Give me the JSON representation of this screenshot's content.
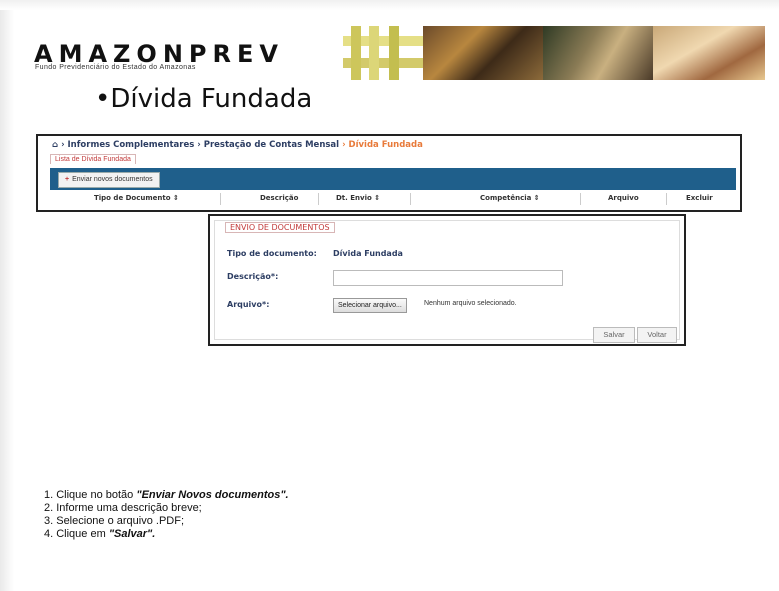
{
  "logo": {
    "title": "AMAZONPREV",
    "subtitle": "Fundo Previdenciário do Estado do Amazonas"
  },
  "slide_title": "•Dívida Fundada",
  "breadcrumb": {
    "home_icon": "home-icon",
    "item1": "› Informes Complementares",
    "item2": "› Prestação de Contas Mensal",
    "item3": "› Dívida Fundada"
  },
  "list_tab": "Lista de Dívida Fundada",
  "toolbar": {
    "enviar_icon": "plus-icon",
    "enviar_label": "Enviar novos documentos"
  },
  "table": {
    "columns": [
      "Tipo de Documento ⇕",
      "Descrição",
      "Dt. Envio ⇕",
      "Competência ⇕",
      "Arquivo",
      "Excluir"
    ]
  },
  "form": {
    "legend": "ENVIO DE DOCUMENTOS",
    "tipo_label": "Tipo de documento:",
    "tipo_value": "Dívida Fundada",
    "descricao_label": "Descrição*:",
    "descricao_value": "",
    "arquivo_label": "Arquivo*:",
    "file_button": "Selecionar arquivo...",
    "file_status": "Nenhum arquivo selecionado.",
    "save_label": "Salvar",
    "back_label": "Voltar"
  },
  "instructions": {
    "step1_prefix": "1. Clique no botão ",
    "step1_bold": "\"Enviar Novos documentos\".",
    "step2": "2. Informe  uma  descrição breve;",
    "step3": "3. Selecione o arquivo .PDF;",
    "step4_prefix": "4. Clique em ",
    "step4_bold": "\"Salvar\"."
  },
  "colors": {
    "toolbar_bg": "#1f5f8b",
    "accent_orange": "#e87a3a",
    "label_blue": "#2d3e63",
    "legend_red": "#c23a3a"
  }
}
